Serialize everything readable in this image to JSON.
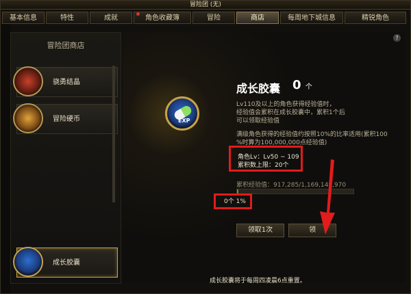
{
  "window": {
    "title": "冒险团 (无)"
  },
  "tabs": [
    {
      "label": "基本信息",
      "active": false,
      "dot": false
    },
    {
      "label": "特性",
      "active": false,
      "dot": false
    },
    {
      "label": "成就",
      "active": false,
      "dot": false
    },
    {
      "label": "角色收藏簿",
      "active": false,
      "dot": true
    },
    {
      "label": "冒险",
      "active": false,
      "dot": false
    },
    {
      "label": "商店",
      "active": true,
      "dot": false
    },
    {
      "label": "每周地下城信息",
      "active": false,
      "dot": false
    },
    {
      "label": "精锐角色",
      "active": false,
      "dot": false
    }
  ],
  "shop": {
    "title": "冒险团商店",
    "items": [
      {
        "label": "骁勇结晶",
        "icon": "red-crystal-icon"
      },
      {
        "label": "冒险硬币",
        "icon": "treasure-chest-icon"
      },
      {
        "label": "成长胶囊",
        "icon": "exp-capsule-icon",
        "selected": true
      }
    ]
  },
  "detail": {
    "title": "成长胶囊",
    "count": "0",
    "count_unit": "个",
    "desc1": "Lv110及以上的角色获得经验值时，",
    "desc2": "经验值会累积在成长胶囊中，累积1个后",
    "desc3": "可以领取经验值",
    "desc4": "满级角色获得的经验值约按照10%的比率适用(累积100",
    "desc5": "%时算为100,000,000点经验值)",
    "level_req": "角色Lv：Lv50 ~ 109",
    "max_stack": "累积数上限：20个",
    "exp_label": "累积经验值：917,285/1,169,149,970",
    "progress_text": "0个 1%",
    "progress_pct": 1,
    "btn_claim_one": "领取1次",
    "btn_claim_all": "领",
    "footer": "成长胶囊将于每周四凌晨6点重置。"
  },
  "help": "?",
  "colors": {
    "accent": "#c9a437",
    "annotation": "#e11c1c"
  }
}
